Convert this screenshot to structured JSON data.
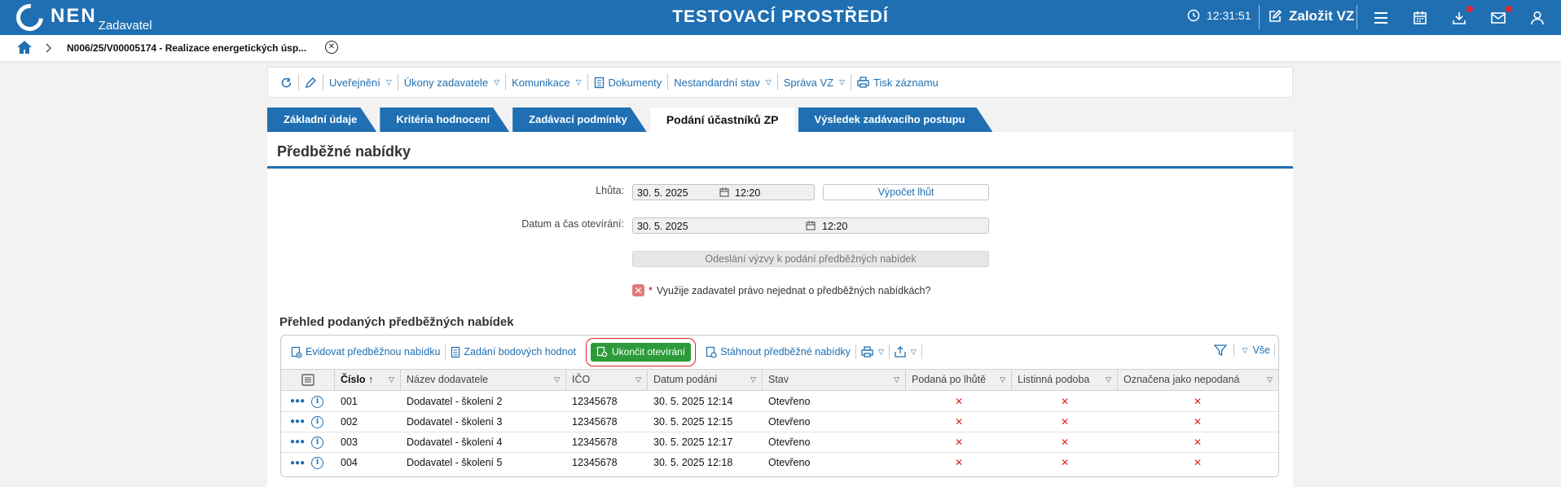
{
  "header": {
    "logo_text": "NEN",
    "logo_sub": "Zadavatel",
    "env_title": "TESTOVACÍ PROSTŘEDÍ",
    "time": "12:31:51",
    "create_label": "Založit VZ",
    "icons": [
      "clock-icon",
      "edit-icon",
      "menu-icon",
      "calendar-icon",
      "download-icon",
      "mail-icon",
      "user-icon"
    ],
    "notification_color": "#e3242b",
    "brand_color": "#1f6fb2"
  },
  "breadcrumb": {
    "text": "N006/25/V00005174 - Realizace energetických úsp..."
  },
  "toolbar": {
    "items": [
      {
        "label": ""
      },
      {
        "label": ""
      },
      {
        "label": "Uveřejnění"
      },
      {
        "label": "Úkony zadavatele"
      },
      {
        "label": "Komunikace"
      },
      {
        "label": "Dokumenty"
      },
      {
        "label": "Nestandardní stav"
      },
      {
        "label": "Správa VZ"
      },
      {
        "label": "Tisk záznamu"
      }
    ]
  },
  "tabs": [
    {
      "label": "Základní údaje",
      "active": false
    },
    {
      "label": "Kritéria hodnocení",
      "active": false
    },
    {
      "label": "Zadávací podmínky",
      "active": false
    },
    {
      "label": "Podání účastníků ZP",
      "active": true
    },
    {
      "label": "Výsledek zadávacího postupu",
      "active": false
    }
  ],
  "panel": {
    "title": "Předběžné nabídky",
    "deadline_label": "Lhůta:",
    "deadline_date": "30. 5. 2025",
    "deadline_time": "12:20",
    "calc_button": "Výpočet lhůt",
    "opening_label": "Datum a čas otevírání:",
    "opening_date": "30. 5. 2025",
    "opening_time": "12:20",
    "send_button": "Odeslání výzvy k podání předběžných nabídek",
    "checkbox_required": "*",
    "checkbox_label": "Využije zadavatel právo nejednat o předběžných nabídkách?",
    "checkbox_checked": false
  },
  "grid": {
    "title": "Přehled podaných předběžných nabídek",
    "toolbar": {
      "record_label": "Evidovat předběžnou nabídku",
      "points_label": "Zadání bodových hodnot",
      "finish_label": "Ukončit otevírání",
      "download_label": "Stáhnout předběžné nabídky",
      "all_label": "Vše",
      "highlight_color": "#2e9b3a"
    },
    "columns": [
      "Číslo",
      "Název dodavatele",
      "IČO",
      "Datum podání",
      "Stav",
      "Podaná po lhůtě",
      "Listinná podoba",
      "Označena jako nepodaná"
    ],
    "rows": [
      {
        "cislo": "001",
        "nazev": "Dodavatel - školení 2",
        "ico": "12345678",
        "datum": "30. 5. 2025 12:14",
        "stav": "Otevřeno",
        "po_lhute": "✕",
        "listinna": "✕",
        "nepodana": "✕"
      },
      {
        "cislo": "002",
        "nazev": "Dodavatel - školení 3",
        "ico": "12345678",
        "datum": "30. 5. 2025 12:15",
        "stav": "Otevřeno",
        "po_lhute": "✕",
        "listinna": "✕",
        "nepodana": "✕"
      },
      {
        "cislo": "003",
        "nazev": "Dodavatel - školení 4",
        "ico": "12345678",
        "datum": "30. 5. 2025 12:17",
        "stav": "Otevřeno",
        "po_lhute": "✕",
        "listinna": "✕",
        "nepodana": "✕"
      },
      {
        "cislo": "004",
        "nazev": "Dodavatel - školení 5",
        "ico": "12345678",
        "datum": "30. 5. 2025 12:18",
        "stav": "Otevřeno",
        "po_lhute": "✕",
        "listinna": "✕",
        "nepodana": "✕"
      }
    ]
  }
}
